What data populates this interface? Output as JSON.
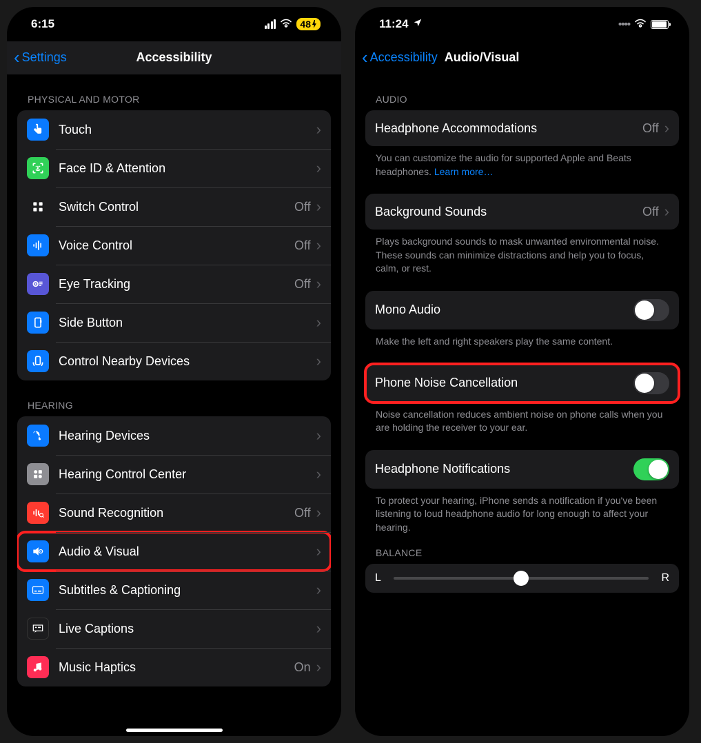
{
  "left": {
    "status": {
      "time": "6:15",
      "battery": "48"
    },
    "nav": {
      "back": "Settings",
      "title": "Accessibility"
    },
    "sec1": {
      "header": "PHYSICAL AND MOTOR",
      "rows": [
        {
          "label": "Touch",
          "value": ""
        },
        {
          "label": "Face ID & Attention",
          "value": ""
        },
        {
          "label": "Switch Control",
          "value": "Off"
        },
        {
          "label": "Voice Control",
          "value": "Off"
        },
        {
          "label": "Eye Tracking",
          "value": "Off"
        },
        {
          "label": "Side Button",
          "value": ""
        },
        {
          "label": "Control Nearby Devices",
          "value": ""
        }
      ]
    },
    "sec2": {
      "header": "HEARING",
      "rows": [
        {
          "label": "Hearing Devices",
          "value": ""
        },
        {
          "label": "Hearing Control Center",
          "value": ""
        },
        {
          "label": "Sound Recognition",
          "value": "Off"
        },
        {
          "label": "Audio & Visual",
          "value": ""
        },
        {
          "label": "Subtitles & Captioning",
          "value": ""
        },
        {
          "label": "Live Captions",
          "value": ""
        },
        {
          "label": "Music Haptics",
          "value": "On"
        }
      ]
    }
  },
  "right": {
    "status": {
      "time": "11:24"
    },
    "nav": {
      "back": "Accessibility",
      "title": "Audio/Visual"
    },
    "audio_header": "AUDIO",
    "headphone_accom": {
      "label": "Headphone Accommodations",
      "value": "Off"
    },
    "headphone_footer": "You can customize the audio for supported Apple and Beats headphones. ",
    "learn_more": "Learn more…",
    "bg_sounds": {
      "label": "Background Sounds",
      "value": "Off"
    },
    "bg_footer": "Plays background sounds to mask unwanted environmental noise. These sounds can minimize distractions and help you to focus, calm, or rest.",
    "mono": {
      "label": "Mono Audio"
    },
    "mono_footer": "Make the left and right speakers play the same content.",
    "noise": {
      "label": "Phone Noise Cancellation"
    },
    "noise_footer": "Noise cancellation reduces ambient noise on phone calls when you are holding the receiver to your ear.",
    "headphone_notif": {
      "label": "Headphone Notifications"
    },
    "notif_footer": "To protect your hearing, iPhone sends a notification if you've been listening to loud headphone audio for long enough to affect your hearing.",
    "balance_header": "BALANCE",
    "balance": {
      "left": "L",
      "right": "R"
    }
  }
}
